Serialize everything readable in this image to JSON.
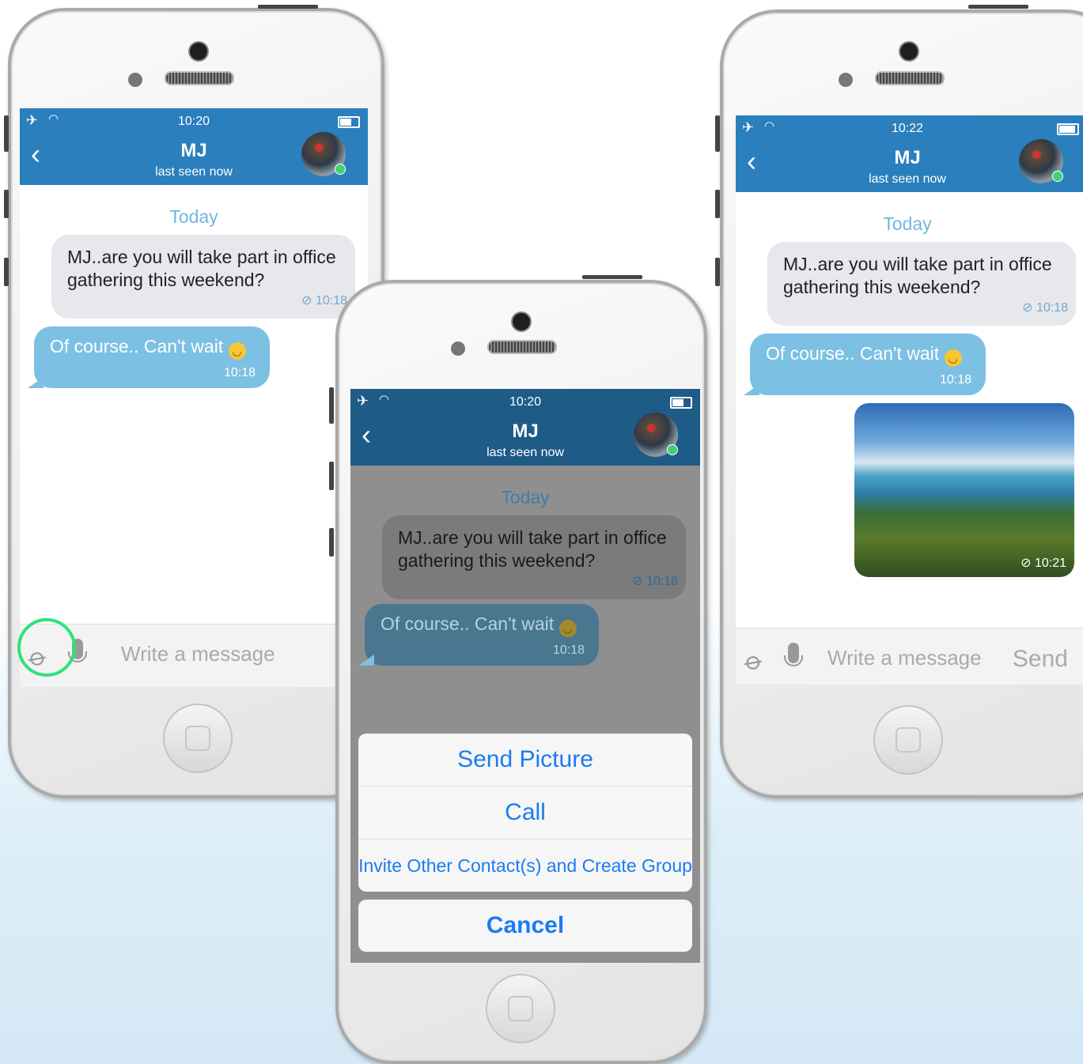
{
  "status_time": [
    "10:20",
    "10:20",
    "10:22"
  ],
  "chat": {
    "contact_name": "MJ",
    "contact_status": "last seen now",
    "date_label": "Today",
    "incoming": {
      "text": "MJ..are you will take part in office gathering this weekend?",
      "time": "10:18"
    },
    "outgoing": {
      "text": "Of course.. Can't wait",
      "time": "10:18"
    },
    "photo_time": "10:21"
  },
  "input": {
    "placeholder": "Write a message",
    "send_label": "Send"
  },
  "action_sheet": {
    "items": [
      "Send Picture",
      "Call",
      "Invite Other Contact(s) and Create Group"
    ],
    "cancel": "Cancel"
  },
  "icons": {
    "attach": "paperclip-icon",
    "mic": "microphone-icon",
    "back": "chevron-left-icon",
    "airplane": "airplane-icon",
    "wifi": "wifi-icon",
    "battery": "battery-icon"
  },
  "colors": {
    "header": "#2a7fbc",
    "outgoing_bubble": "#7cc0e4",
    "incoming_bubble": "#e7e7ec",
    "action_text": "#1b7cf2",
    "highlight_ring": "#2de27a"
  }
}
